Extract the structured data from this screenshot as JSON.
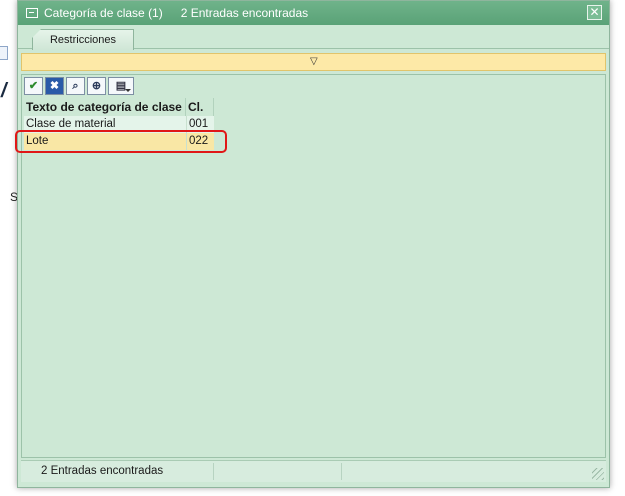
{
  "background": {
    "fragment_s": "S",
    "fragment_slash": "/"
  },
  "dialog": {
    "title": "Categoría de clase (1)",
    "subtitle": "2 Entradas encontradas",
    "close_symbol": "✕",
    "accent_color": "#5aa277",
    "highlight_color": "#e01717"
  },
  "tabs": [
    {
      "label": "Restricciones",
      "active": true
    }
  ],
  "filter_bar": {
    "icon": "filter-icon",
    "symbol": "▽"
  },
  "toolbar": {
    "buttons": [
      {
        "name": "check-icon",
        "symbol": "✔"
      },
      {
        "name": "cancel-icon",
        "symbol": "✖"
      },
      {
        "name": "find-icon",
        "symbol": "🔍"
      },
      {
        "name": "find-next-icon",
        "symbol": "⊕"
      },
      {
        "name": "print-icon",
        "symbol": "▤"
      }
    ]
  },
  "table": {
    "columns": [
      "Texto de categoría de clase",
      "Cl."
    ],
    "rows": [
      {
        "text": "Clase de material",
        "code": "001",
        "selected": false
      },
      {
        "text": "Lote",
        "code": "022",
        "selected": true
      }
    ]
  },
  "status": {
    "text": "2 Entradas encontradas"
  }
}
